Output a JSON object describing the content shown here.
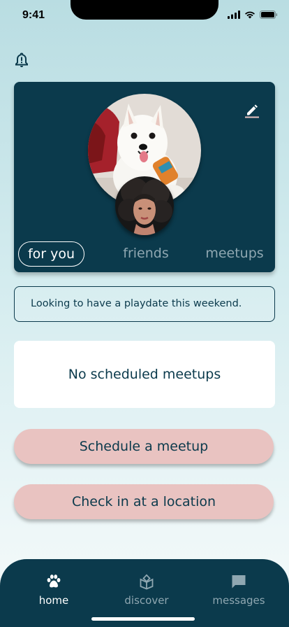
{
  "status_bar": {
    "time": "9:41"
  },
  "icons": {
    "bell": "bell-alert-icon",
    "edit": "pencil-icon",
    "home": "paw-icon",
    "discover": "open-box-icon",
    "messages": "chat-bubble-icon"
  },
  "profile": {
    "pet_photo": "white-dog-photo",
    "owner_photo": "owner-portrait-photo",
    "tabs": [
      {
        "label": "for you",
        "active": true
      },
      {
        "label": "friends",
        "active": false
      },
      {
        "label": "meetups",
        "active": false
      }
    ]
  },
  "status_message": "Looking to have a playdate this weekend.",
  "meetups": {
    "empty_text": "No scheduled meetups"
  },
  "actions": {
    "schedule": "Schedule a meetup",
    "checkin": "Check in at a location"
  },
  "nav": {
    "items": [
      {
        "label": "home",
        "active": true
      },
      {
        "label": "discover",
        "active": false
      },
      {
        "label": "messages",
        "active": false
      }
    ]
  },
  "colors": {
    "primary": "#0b3a4c",
    "accent_pink": "#e9c3c1",
    "inactive": "#8fa7b1",
    "background_top": "#b9dde2"
  }
}
